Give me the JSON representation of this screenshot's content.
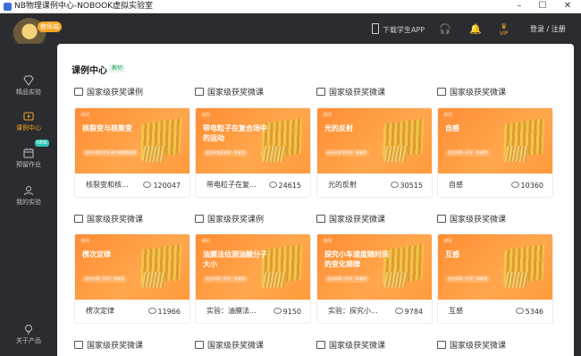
{
  "window": {
    "title": "NB物理课例中心-NOBOOK虚拟实验室"
  },
  "header": {
    "logo_badge": "教师端",
    "download_app": "下载学生APP",
    "vip": "VIP",
    "login": "登录 / 注册"
  },
  "sidebar": {
    "items": [
      {
        "label": "精品实验",
        "icon": "gem-icon"
      },
      {
        "label": "课例中心",
        "icon": "video-icon",
        "active": true
      },
      {
        "label": "预留作业",
        "icon": "calendar-icon",
        "badge": "NEW"
      },
      {
        "label": "我的实验",
        "icon": "user-icon"
      },
      {
        "label": "关于产品",
        "icon": "bulb-icon"
      }
    ]
  },
  "main": {
    "title": "课例中心",
    "tag": "教师",
    "cards": [
      {
        "category": "国家级获奖课例",
        "thumb_title": "核裂变与核聚变",
        "thumb_sub": "北京市第四中学·高中物理教研组",
        "name": "核裂变和核...",
        "views": "120047"
      },
      {
        "category": "国家级获奖微课",
        "thumb_title": "带电粒子在复合场中的运动",
        "thumb_sub": "北京市育英学校 · 李老师",
        "name": "带电粒子在复...",
        "views": "24615"
      },
      {
        "category": "国家级获奖微课",
        "thumb_title": "光的反射",
        "thumb_sub": "杭州市学军中学 · 张老师",
        "name": "光的反射",
        "views": "30515"
      },
      {
        "category": "国家级获奖微课",
        "thumb_title": "自感",
        "thumb_sub": "北京市第一中学 · 李老师",
        "name": "自感",
        "views": "10360"
      },
      {
        "category": "国家级获奖微课",
        "thumb_title": "楞次定律",
        "thumb_sub": "北京市第一中学 · 李老师",
        "name": "楞次定律",
        "views": "11966"
      },
      {
        "category": "国家级获奖课例",
        "thumb_title": "油膜法估测油酸分子大小",
        "thumb_sub": "北京市第一中学 · 李老师",
        "name": "实验：油膜法...",
        "views": "9150"
      },
      {
        "category": "国家级获奖微课",
        "thumb_title": "探究小车速度随时间的变化规律",
        "thumb_sub": "北京市第一中学 · 李老师",
        "name": "实验：探究小...",
        "views": "9784"
      },
      {
        "category": "国家级获奖微课",
        "thumb_title": "互感",
        "thumb_sub": "北京市第一中学 · 李老师",
        "name": "互感",
        "views": "5346"
      },
      {
        "category": "国家级获奖微课"
      },
      {
        "category": "国家级获奖微课"
      },
      {
        "category": "国家级获奖微课"
      },
      {
        "category": "国家级获奖微课"
      }
    ]
  }
}
